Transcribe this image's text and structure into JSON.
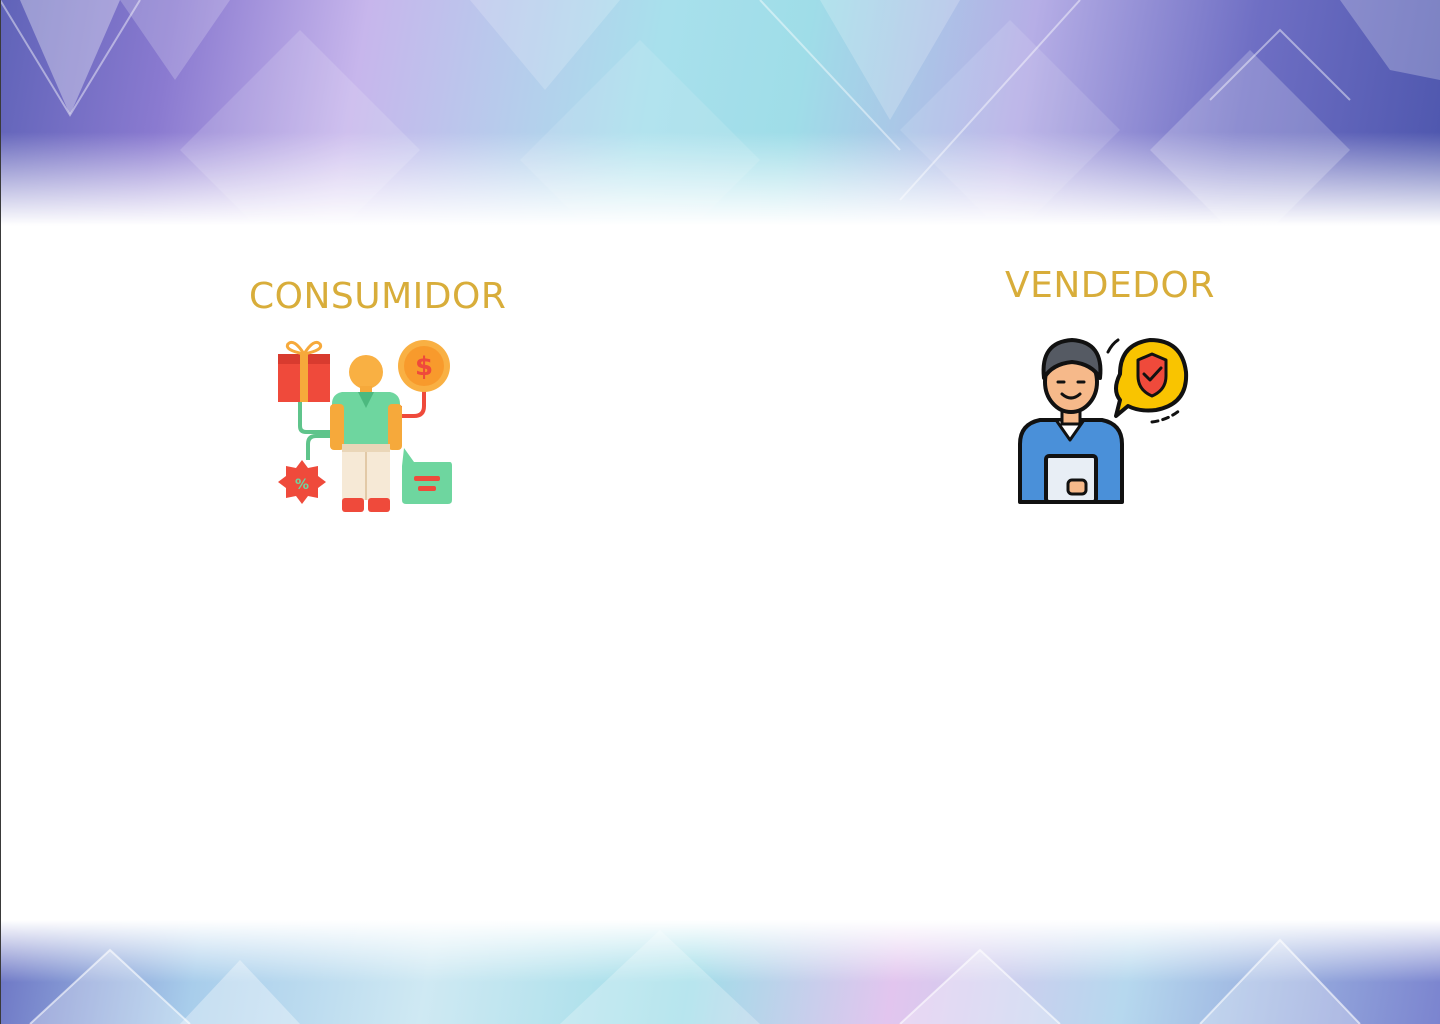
{
  "slide": {
    "consumer": {
      "title": "CONSUMIDOR",
      "icon": "consumer-icon"
    },
    "seller": {
      "title": "VENDEDOR",
      "icon": "seller-icon"
    }
  },
  "colors": {
    "title": "#d8ad3a",
    "background": "#ffffff"
  }
}
